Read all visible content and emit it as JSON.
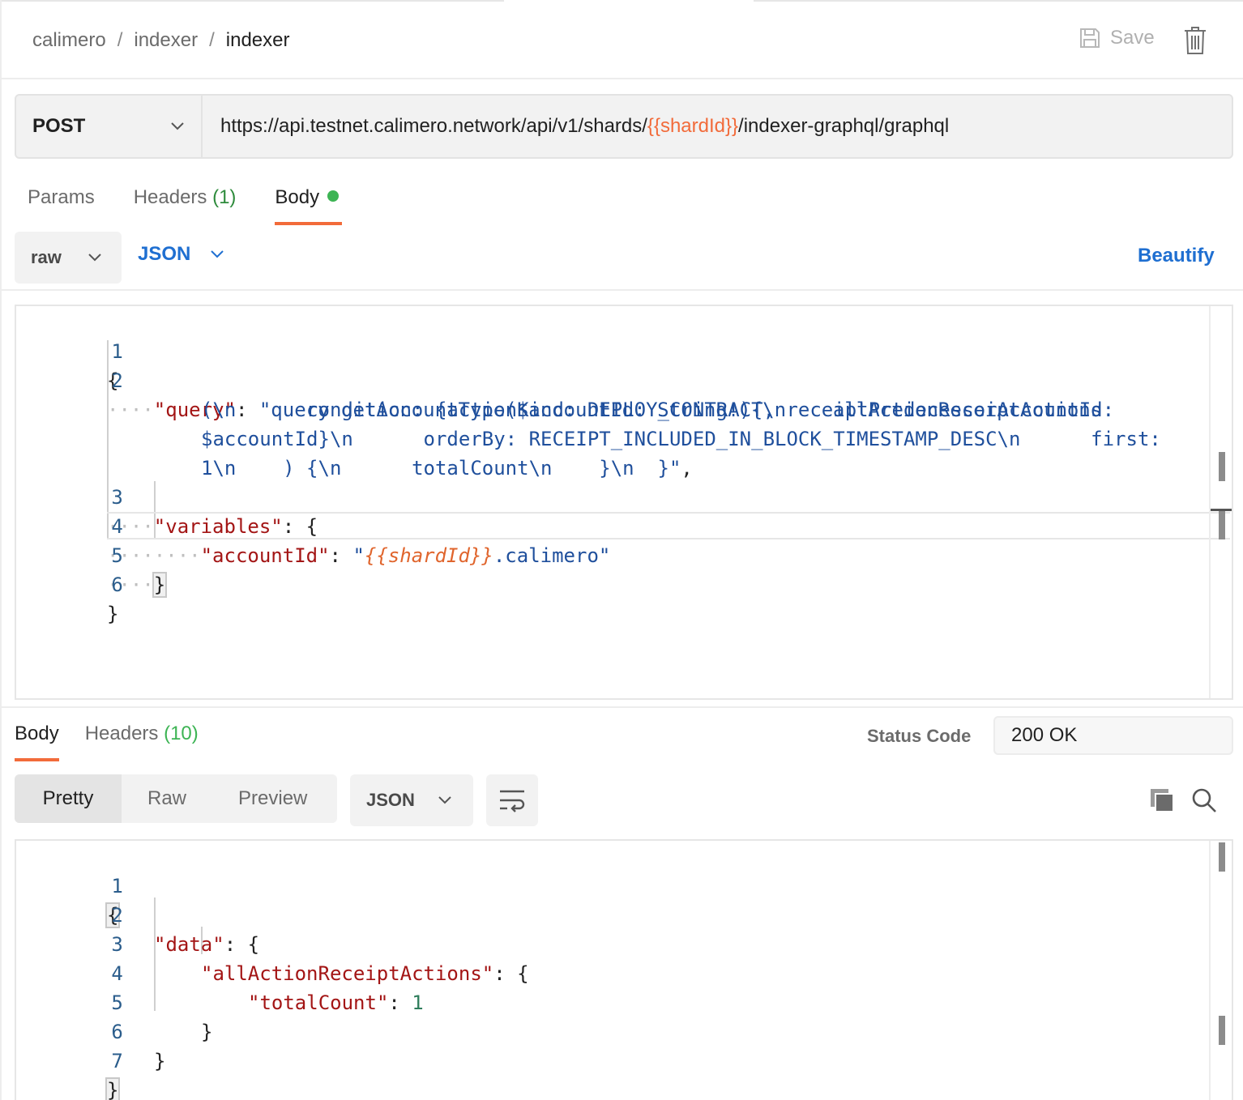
{
  "breadcrumb": {
    "items": [
      "calimero",
      "indexer"
    ],
    "separator": "/",
    "current": "indexer"
  },
  "header": {
    "save_label": "Save"
  },
  "request": {
    "method": "POST",
    "url_prefix": "https://api.testnet.calimero.network/api/v1/shards/",
    "url_variable": "{{shardId}}",
    "url_suffix": "/indexer-graphql/graphql"
  },
  "request_tabs": {
    "params": "Params",
    "headers": "Headers",
    "headers_count": "(1)",
    "body": "Body"
  },
  "body_options": {
    "mode": "raw",
    "language": "JSON",
    "beautify": "Beautify"
  },
  "request_body": {
    "line_numbers": [
      "1",
      "2",
      "3",
      "4",
      "5",
      "6"
    ],
    "l1": "{",
    "l2_key": "\"query\"",
    "l2_colon": ": ",
    "l2a": "\"query getAccountType($accountId: String!){\\n    allActionReceiptActions",
    "l2b": "(\\n      condition: {actionKind: DEPLOY_CONTRACT, receiptPredecessorAccountId:",
    "l2c": "$accountId}\\n      orderBy: RECEIPT_INCLUDED_IN_BLOCK_TIMESTAMP_DESC\\n      first:",
    "l2d": "1\\n    ) {\\n      totalCount\\n    }\\n  }\"",
    "l2d_end": ",",
    "l3_key": "\"variables\"",
    "l3_rest": ": {",
    "l4_key": "\"accountId\"",
    "l4_colon": ": ",
    "l4_q1": "\"",
    "l4_var": "{{shardId}}",
    "l4_rest": ".calimero\"",
    "l5": "}",
    "l6": "}"
  },
  "response_tabs": {
    "body": "Body",
    "headers": "Headers",
    "headers_count": "(10)"
  },
  "status": {
    "label": "Status Code",
    "value": "200 OK"
  },
  "view_modes": {
    "pretty": "Pretty",
    "raw": "Raw",
    "preview": "Preview"
  },
  "response_format": "JSON",
  "response_body": {
    "line_numbers": [
      "1",
      "2",
      "3",
      "4",
      "5",
      "6",
      "7"
    ],
    "l1": "{",
    "l2_key": "\"data\"",
    "l2_rest": ": {",
    "l3_key": "\"allActionReceiptActions\"",
    "l3_rest": ": {",
    "l4_key": "\"totalCount\"",
    "l4_colon": ": ",
    "l4_val": "1",
    "l5": "}",
    "l6": "}",
    "l7": "}"
  },
  "colors": {
    "accent": "#f26b3a",
    "link_blue": "#1f6fd1",
    "green": "#3db454"
  },
  "icons": [
    "save-icon",
    "trash-icon",
    "chevron-down-icon",
    "wrap-lines-icon",
    "copy-icon",
    "search-icon"
  ]
}
